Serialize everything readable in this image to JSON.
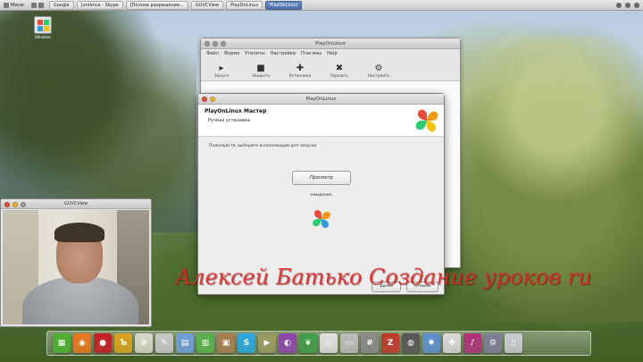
{
  "menubar": {
    "apps_label": "Меню",
    "tasks": [
      {
        "label": "Google"
      },
      {
        "label": "[unfence - Skype"
      },
      {
        "label": "[Полное разрешение..."
      },
      {
        "label": "GUVCView"
      },
      {
        "label": "PlayOnLinux"
      },
      {
        "label": "PlayOnLinux",
        "active": true
      }
    ]
  },
  "desktop_icon": {
    "label": "Windows"
  },
  "pol_main": {
    "title": "PlayOnLinux",
    "menu": [
      "Файл",
      "Форма",
      "Утилиты",
      "Настройки",
      "Плагины",
      "Help"
    ],
    "toolbar": [
      {
        "label": "Запуск",
        "icon": "play-icon"
      },
      {
        "label": "Закрыть",
        "icon": "stop-icon"
      },
      {
        "label": "Установка",
        "icon": "plus-icon"
      },
      {
        "label": "Удалить",
        "icon": "remove-icon"
      },
      {
        "label": "Настроить",
        "icon": "gear-icon"
      }
    ]
  },
  "wizard": {
    "title": "PlayOnLinux",
    "heading": "PlayOnLinux Мастер",
    "subheading": "Ручная установка",
    "instruction": "Пожалуйста, выберите исполняющий для запуска",
    "browse_label": "Просмотр",
    "status": "ожидание",
    "next_label": "Далее",
    "cancel_label": "Отмена"
  },
  "webcam": {
    "title": "GUVCView"
  },
  "watermark": "Алексей Батько Создание уроков ru",
  "dock": [
    {
      "name": "spreadsheet",
      "glyph": "▦",
      "color": "#4caf2e"
    },
    {
      "name": "firefox",
      "glyph": "◉",
      "color": "#e8761e"
    },
    {
      "name": "red-app",
      "glyph": "●",
      "color": "#c41d24"
    },
    {
      "name": "dict",
      "glyph": "Ъ",
      "color": "#d9a21b"
    },
    {
      "name": "notes",
      "glyph": "≡",
      "color": "#d8d8c8"
    },
    {
      "name": "text-editor",
      "glyph": "✎",
      "color": "#c9c9c9"
    },
    {
      "name": "files",
      "glyph": "▤",
      "color": "#6fa0d8"
    },
    {
      "name": "calc",
      "glyph": "▥",
      "color": "#59b04a"
    },
    {
      "name": "archive",
      "glyph": "▣",
      "color": "#a67c4e"
    },
    {
      "name": "skype",
      "glyph": "S",
      "color": "#2aa6e0"
    },
    {
      "name": "video",
      "glyph": "▶",
      "color": "#9a9a60"
    },
    {
      "name": "purple",
      "glyph": "◐",
      "color": "#8e44ad"
    },
    {
      "name": "leaf",
      "glyph": "❦",
      "color": "#3f9c4a"
    },
    {
      "name": "webcam",
      "glyph": "◎",
      "color": "#e0e0e0"
    },
    {
      "name": "terminal",
      "glyph": "▭",
      "color": "#bcbcbc"
    },
    {
      "name": "calculator",
      "glyph": "#",
      "color": "#8a8a8a"
    },
    {
      "name": "filezilla",
      "glyph": "Z",
      "color": "#c0392b"
    },
    {
      "name": "disc",
      "glyph": "◍",
      "color": "#555555"
    },
    {
      "name": "sun",
      "glyph": "✹",
      "color": "#5d8fce"
    },
    {
      "name": "clover",
      "glyph": "✤",
      "color": "#d9d9d9"
    },
    {
      "name": "music",
      "glyph": "♪",
      "color": "#b0307a"
    },
    {
      "name": "system",
      "glyph": "⚙",
      "color": "#7d7d9a"
    },
    {
      "name": "trash",
      "glyph": "▯",
      "color": "#c8ccd2"
    }
  ]
}
